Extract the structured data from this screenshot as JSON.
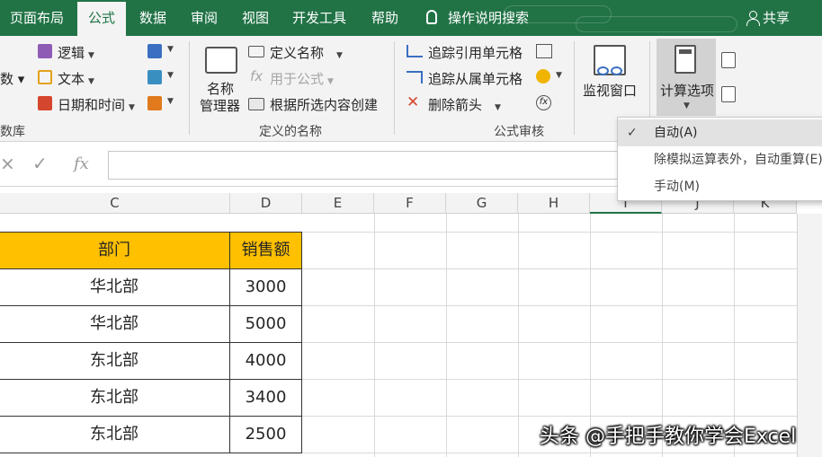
{
  "tabs": [
    {
      "label": "页面布局",
      "active": false
    },
    {
      "label": "公式",
      "active": true
    },
    {
      "label": "数据",
      "active": false
    },
    {
      "label": "审阅",
      "active": false
    },
    {
      "label": "视图",
      "active": false
    },
    {
      "label": "开发工具",
      "active": false
    },
    {
      "label": "帮助",
      "active": false
    }
  ],
  "tell_me": "操作说明搜索",
  "share": "共享",
  "ribbon": {
    "library": {
      "partial_items": [
        "数 ▾",
        "数库"
      ],
      "logic": "逻辑",
      "text": "文本",
      "datetime": "日期和时间",
      "title": "数库"
    },
    "defined_names": {
      "name_manager_line1": "名称",
      "name_manager_line2": "管理器",
      "define_name": "定义名称",
      "use_in_formula": "用于公式",
      "create_from_selection": "根据所选内容创建",
      "title": "定义的名称"
    },
    "auditing": {
      "trace_precedents": "追踪引用单元格",
      "trace_dependents": "追踪从属单元格",
      "remove_arrows": "删除箭头",
      "title": "公式审核"
    },
    "watch_window": "监视窗口",
    "calc_options": "计算选项"
  },
  "formula_bar": {
    "cancel": "×",
    "enter": "✓",
    "fx": "fx",
    "value": ""
  },
  "columns": [
    "C",
    "D",
    "E",
    "F",
    "G",
    "H",
    "I",
    "J",
    "K"
  ],
  "table": {
    "headers": [
      "部门",
      "销售额"
    ],
    "rows": [
      [
        "华北部",
        "3000"
      ],
      [
        "华北部",
        "5000"
      ],
      [
        "东北部",
        "4000"
      ],
      [
        "东北部",
        "3400"
      ],
      [
        "东北部",
        "2500"
      ]
    ]
  },
  "calc_menu": {
    "items": [
      {
        "label": "自动(A)",
        "checked": true
      },
      {
        "label": "除模拟运算表外，自动重算(E)",
        "checked": false
      },
      {
        "label": "手动(M)",
        "checked": false
      }
    ]
  },
  "watermark": "头条 @手把手教你学会Excel",
  "colors": {
    "excel_green": "#217346",
    "header_fill": "#ffc000",
    "ribbon_bg": "#f3f3f3"
  }
}
